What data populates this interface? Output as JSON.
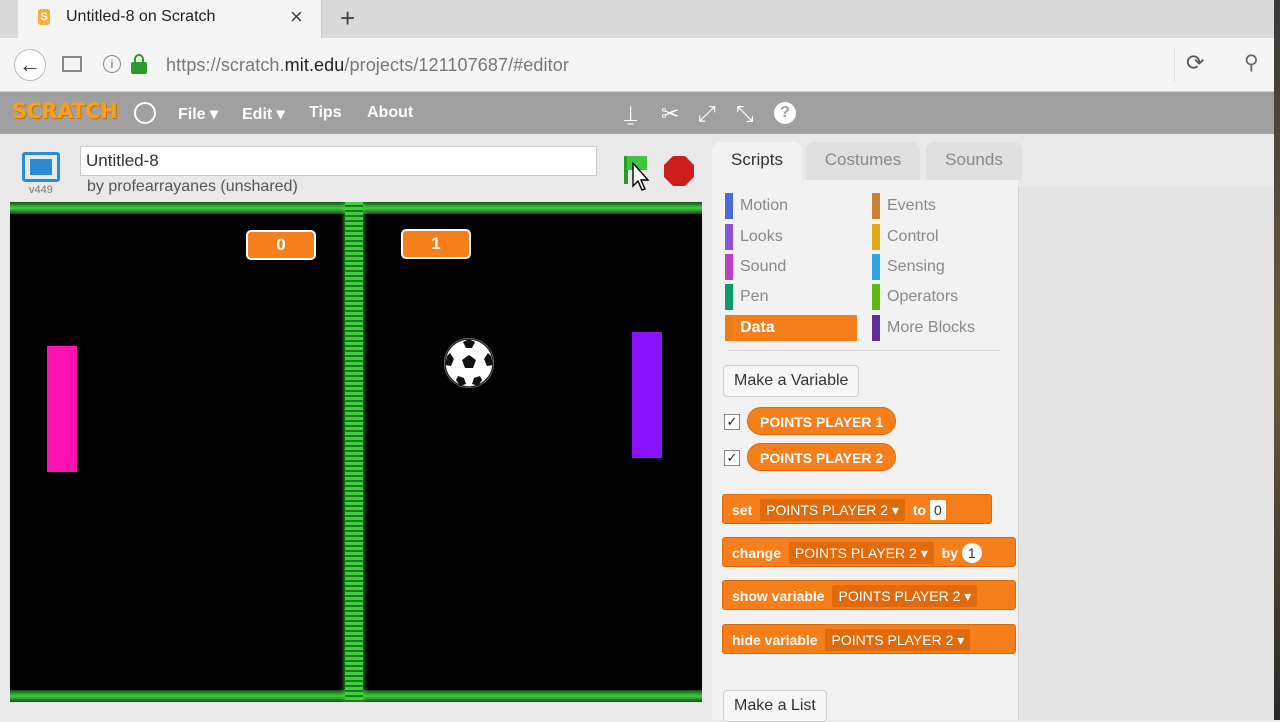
{
  "browser": {
    "tab_title": "Untitled-8 on Scratch",
    "favicon_letter": "S",
    "close_glyph": "×",
    "newtab_glyph": "+",
    "back_glyph": "←",
    "info_glyph": "i",
    "url_scheme": "https://scratch.",
    "url_host": "mit.edu",
    "url_path": "/projects/121107687/#editor",
    "reload_glyph": "⟳",
    "search_glyph": "⚲"
  },
  "menubar": {
    "logo": "SCRATCH",
    "file": "File ▾",
    "edit": "Edit ▾",
    "tips": "Tips",
    "about": "About",
    "help": "?",
    "duplicate_glyph": "⍊",
    "cut_glyph": "✂",
    "grow_glyph": "⤢",
    "shrink_glyph": "⤡"
  },
  "project": {
    "title": "Untitled-8",
    "byline": "by profearrayanes (unshared)",
    "version": "v449"
  },
  "stage": {
    "score_left": "0",
    "score_right": "1",
    "colors": {
      "left_paddle": "#ff12b4",
      "right_paddle": "#8a12ff",
      "score_bg": "#f67f1c"
    }
  },
  "tabs": {
    "scripts": "Scripts",
    "costumes": "Costumes",
    "sounds": "Sounds"
  },
  "categories": [
    {
      "label": "Motion",
      "color": "#4a6cd4"
    },
    {
      "label": "Looks",
      "color": "#8a55d7"
    },
    {
      "label": "Sound",
      "color": "#bb42c3"
    },
    {
      "label": "Pen",
      "color": "#0e9a6c"
    },
    {
      "label": "Data",
      "color": "#ee7d16"
    },
    {
      "label": "Events",
      "color": "#c88330"
    },
    {
      "label": "Control",
      "color": "#e1a91a"
    },
    {
      "label": "Sensing",
      "color": "#2ca5e2"
    },
    {
      "label": "Operators",
      "color": "#5cb712"
    },
    {
      "label": "More Blocks",
      "color": "#632d99"
    }
  ],
  "palette": {
    "make_variable": "Make a Variable",
    "make_list": "Make a List",
    "check_glyph": "✓",
    "variables": [
      "POINTS PLAYER 1",
      "POINTS PLAYER 2"
    ],
    "blocks": {
      "set_label": "set",
      "set_var": "POINTS PLAYER 2 ▾",
      "set_to": "to",
      "set_value": "0",
      "change_label": "change",
      "change_var": "POINTS PLAYER 2 ▾",
      "change_by": "by",
      "change_value": "1",
      "show_label": "show variable",
      "show_var": "POINTS PLAYER 2 ▾",
      "hide_label": "hide variable",
      "hide_var": "POINTS PLAYER 2 ▾"
    }
  }
}
